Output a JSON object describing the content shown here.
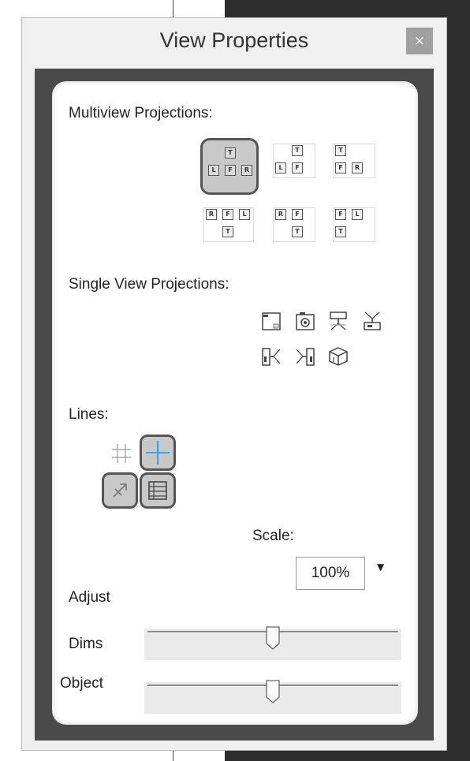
{
  "window": {
    "title": "View Properties",
    "close_label": "×"
  },
  "sections": {
    "multiview_label": "Multiview Projections:",
    "singleview_label": "Single View Projections:",
    "lines_label": "Lines:",
    "scale_label": "Scale:",
    "adjust_label": "Adjust",
    "dims_label": "Dims",
    "object_label": "Object"
  },
  "multiview": {
    "cell_labels": {
      "top": "T",
      "left": "L",
      "front": "F",
      "right": "R"
    },
    "selected": "T-LFR"
  },
  "single_view_icons": [
    "frame-corner-icon",
    "camera-icon",
    "top-projector-icon",
    "bottom-projector-icon",
    "left-projector-icon",
    "right-projector-icon",
    "isometric-cube-icon"
  ],
  "lines_icons": [
    "hash-grid-icon",
    "crosshair-icon",
    "plane-icon",
    "hatch-icon"
  ],
  "scale": {
    "value": "100%"
  },
  "sliders": {
    "dims_level": 0.5,
    "object_level": 0.5
  },
  "colors": {
    "accent_blue": "#3a9ad9",
    "selected_fill": "#c8c8c8",
    "border_dark": "#555555"
  }
}
